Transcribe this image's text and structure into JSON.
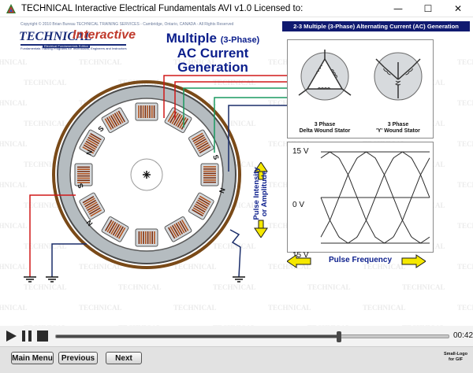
{
  "window": {
    "title": "TECHNICAL Interactive Electrical Fundamentals AVI v1.0    Licensed to:",
    "minimize_glyph": "—",
    "maximize_glyph": "☐",
    "close_glyph": "✕"
  },
  "slide": {
    "copyright": "Copyright © 2010 Brian Bureau TECHNICAL TRAINING SERVICES - Cambridge, Ontario, CANADA - All Rights Reserved",
    "logo_left": "TECHNICAL",
    "logo_right": "Interactive",
    "logo_badge": "Electrical Fundamentals Edition",
    "logo_tagline": "Fundamentals Training Programs for Technicians, Engineers and Instructors",
    "title_line1": "Multiple",
    "title_line1_small": "(3-Phase)",
    "title_line2": "AC Current Generation",
    "lesson_header": "2-3 Multiple (3-Phase) Alternating Current (AC) Generation",
    "watermark_text": "TECHNICAL",
    "stator_labels": {
      "delta": "3 Phase\nDelta Wound Stator",
      "wye": "3 Phase\n'Y' Wound Stator"
    },
    "pole_labels": [
      "S",
      "N",
      "S",
      "N",
      "S",
      "N"
    ],
    "chart": {
      "y_ticks": [
        "15 V",
        "0 V",
        "15 V"
      ],
      "y_label_line1": "Pulse Intensity",
      "y_label_line2": "or Amplitude",
      "x_label": "Pulse Frequency"
    }
  },
  "chart_data": {
    "type": "line",
    "title": "",
    "xlabel": "Pulse Frequency",
    "ylabel": "Pulse Intensity or Amplitude",
    "y_tick_labels": [
      "15 V",
      "0 V",
      "15 V"
    ],
    "ylim": [
      -15,
      15
    ],
    "x_unit": "degrees",
    "x": [
      0,
      30,
      60,
      90,
      120,
      150,
      180,
      210,
      240,
      270,
      300,
      330,
      360
    ],
    "series": [
      {
        "values": [
          -13,
          -7.5,
          0,
          7.5,
          13,
          15,
          13,
          7.5,
          0,
          -7.5,
          -13,
          -15,
          -13
        ]
      },
      {
        "values": [
          13,
          15,
          13,
          7.5,
          0,
          -7.5,
          -13,
          -15,
          -13,
          -7.5,
          0,
          7.5,
          13
        ]
      },
      {
        "values": [
          0,
          -7.5,
          -13,
          -15,
          -13,
          -7.5,
          0,
          7.5,
          13,
          15,
          13,
          7.5,
          0
        ]
      }
    ],
    "colors": {
      "line": "#2b2b2b",
      "gridline": "#2b2b2b"
    },
    "grid": false
  },
  "player": {
    "play_icon": "play-icon",
    "pause_icon": "pause-icon",
    "stop_icon": "stop-icon",
    "progress": 0.72,
    "time": "00:42"
  },
  "nav": {
    "main_menu": "Main Menu",
    "previous": "Previous",
    "next": "Next",
    "small_logo": "Small-Logo\nfor GIF"
  },
  "colors": {
    "title_blue": "#0b1e8c",
    "header_bg": "#101a70",
    "arrow_yellow": "#f5e800",
    "coil_copper": "#b4541e",
    "wire_red": "#d01818",
    "wire_green": "#1a9a60",
    "wire_navy": "#1a2d6a",
    "field_cyan": "#2aa9c9"
  }
}
